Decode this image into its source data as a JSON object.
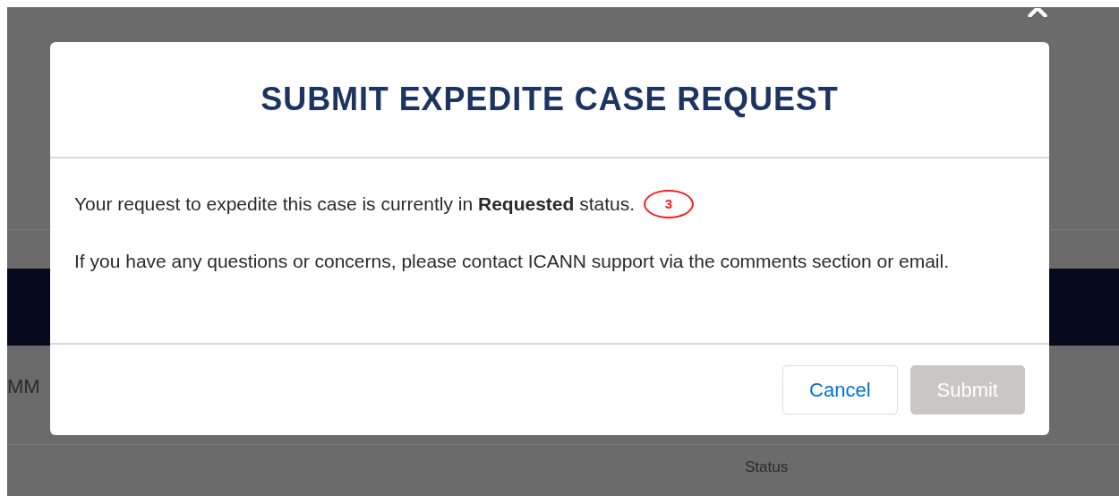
{
  "background": {
    "column_1_fragment": "MM",
    "column_header": "Status"
  },
  "dialog": {
    "title": "SUBMIT EXPEDITE CASE REQUEST",
    "paragraphs": [
      "Your request to expedite this case is currently in **Requested** status.",
      "If you have any questions or concerns, please contact ICANN support via the comments section or email."
    ],
    "annotation": "3",
    "buttons": [
      {
        "label": "Cancel",
        "kind": "secondary",
        "disabled": false
      },
      {
        "label": "Submit",
        "kind": "primary",
        "disabled": true
      }
    ]
  }
}
